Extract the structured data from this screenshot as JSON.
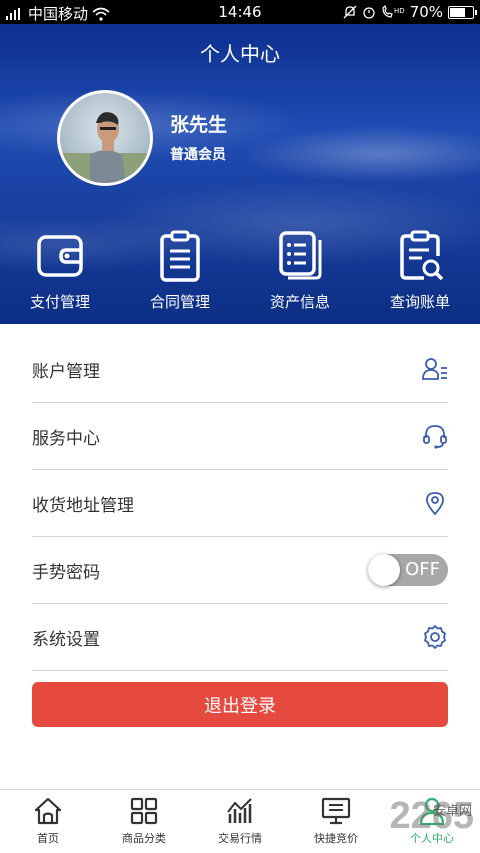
{
  "status_bar": {
    "carrier": "中国移动",
    "time": "14:46",
    "battery": "70%",
    "battery_level": 0.7
  },
  "header": {
    "title": "个人中心",
    "user": {
      "name": "张先生",
      "level": "普通会员"
    }
  },
  "quick_actions": [
    {
      "label": "支付管理",
      "icon": "wallet-icon"
    },
    {
      "label": "合同管理",
      "icon": "clipboard-icon"
    },
    {
      "label": "资产信息",
      "icon": "document-list-icon"
    },
    {
      "label": "查询账单",
      "icon": "search-bill-icon"
    }
  ],
  "menu": [
    {
      "label": "账户管理",
      "icon": "account-icon"
    },
    {
      "label": "服务中心",
      "icon": "headset-icon"
    },
    {
      "label": "收货地址管理",
      "icon": "location-icon"
    },
    {
      "label": "手势密码",
      "toggle": "OFF",
      "enabled": false
    },
    {
      "label": "系统设置",
      "icon": "gear-icon"
    }
  ],
  "logout_label": "退出登录",
  "bottom_nav": [
    {
      "label": "首页",
      "icon": "home-icon"
    },
    {
      "label": "商品分类",
      "icon": "grid-icon"
    },
    {
      "label": "交易行情",
      "icon": "chart-icon"
    },
    {
      "label": "快捷竞价",
      "icon": "monitor-icon"
    },
    {
      "label": "个人中心",
      "icon": "person-icon",
      "active": true
    }
  ],
  "colors": {
    "header": "#1a47ab",
    "icon_blue": "#3a5db0",
    "logout": "#e64a3f",
    "active_nav": "#2fb36b"
  },
  "watermark": {
    "text": "2265",
    "sub": "安卓网"
  }
}
